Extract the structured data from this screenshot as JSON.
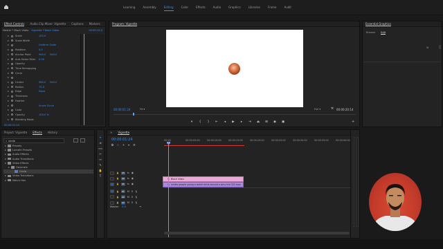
{
  "workspaces": [
    "Learning",
    "Assembly",
    "Editing",
    "Color",
    "Effects",
    "Audio",
    "Graphics",
    "Libraries",
    "Frame",
    "Audit"
  ],
  "active_workspace_index": 2,
  "effect_controls": {
    "tabs": [
      "Effect Controls",
      "Audio Clip Mixer: Vignette",
      "Captions",
      "Markers"
    ],
    "master_label": "Master * Black Video",
    "clip_label": "Vignette * Black Video",
    "timecode": "00:00:15:0",
    "rows": [
      {
        "name": "Scale",
        "value": "100.0",
        "value2": ""
      },
      {
        "name": "Scale Width",
        "value": "",
        "value2": ""
      },
      {
        "name": "",
        "value": "Uniform Scale",
        "value2": ""
      },
      {
        "name": "Rotation",
        "value": "0.0",
        "value2": ""
      },
      {
        "name": "Anchor Point",
        "value": "960.0",
        "value2": "540.0"
      },
      {
        "name": "Anti-flicker Filter",
        "value": "0.00",
        "value2": ""
      },
      {
        "name": "Opacity",
        "value": "",
        "value2": ""
      },
      {
        "name": "Time Remapping",
        "value": "",
        "value2": ""
      },
      {
        "name": "Circle",
        "value": "",
        "value2": ""
      },
      {
        "name": "",
        "value": "",
        "value2": ""
      },
      {
        "name": "Center",
        "value": "960.0",
        "value2": "540.0"
      },
      {
        "name": "Radius",
        "value": "75.0",
        "value2": ""
      },
      {
        "name": "Edge",
        "value": "None",
        "value2": ""
      },
      {
        "name": "Thickness",
        "value": "",
        "value2": ""
      },
      {
        "name": "Feather",
        "value": "",
        "value2": ""
      },
      {
        "name": "",
        "value": "Invert Circle",
        "value2": ""
      },
      {
        "name": "Color",
        "value": "",
        "value2": ""
      },
      {
        "name": "Opacity",
        "value": "100.0 %",
        "value2": ""
      },
      {
        "name": "Blending Mode",
        "value": "",
        "value2": ""
      }
    ],
    "footer_timecode": "00:00:01:24"
  },
  "program_monitor": {
    "title": "Program: Vignette",
    "timecode_left": "00:00:01:24",
    "fit_label": "Fit",
    "quality_label": "Full",
    "timecode_right": "00:00:20:14"
  },
  "essential_graphics": {
    "title": "Essential Graphics",
    "tabs": [
      "Browse",
      "Edit"
    ],
    "active_tab_index": 1,
    "badge": "Vi"
  },
  "project_panel": {
    "tabs": [
      "Project: Vignette",
      "Effects",
      "History"
    ],
    "active_tab_index": 1,
    "search_value": "circle",
    "tree": [
      {
        "label": "Presets",
        "level": 0,
        "type": "folder"
      },
      {
        "label": "Lumetri Presets",
        "level": 0,
        "type": "folder"
      },
      {
        "label": "Audio Effects",
        "level": 0,
        "type": "folder"
      },
      {
        "label": "Audio Transitions",
        "level": 0,
        "type": "folder"
      },
      {
        "label": "Video Effects",
        "level": 0,
        "type": "folder"
      },
      {
        "label": "Generate",
        "level": 1,
        "type": "folder"
      },
      {
        "label": "Circle",
        "level": 2,
        "type": "effect"
      },
      {
        "label": "Video Transitions",
        "level": 0,
        "type": "folder"
      },
      {
        "label": "Match Hex",
        "level": 0,
        "type": "folder"
      }
    ]
  },
  "timeline": {
    "title": "Vignette",
    "timecode": "00:00:01:24",
    "ruler": [
      "00:00",
      "00:00:05:00",
      "00:00:10:00",
      "00:00:15:00",
      "00:00:20:00",
      "00:00:25:00",
      "00:00:30:00",
      "00:00:35:00",
      "00:00:40:00"
    ],
    "video_tracks": [
      "V3",
      "V2",
      "V1"
    ],
    "audio_tracks": [
      "A1",
      "A2",
      "A3"
    ],
    "mix_label": "Master",
    "mix_value": "0.0",
    "clips": [
      {
        "label": "Black Video",
        "track": "V2"
      },
      {
        "label": "smiles people young a watch drink around a sony the-322.mov",
        "track": "V1"
      }
    ]
  },
  "colors": {
    "accent_blue": "#2f8fff",
    "clip_pink": "#e8a8d8",
    "clip_violet": "#a88ad8",
    "playhead": "#5aa0ff",
    "workarea_red": "#d83a3a"
  }
}
